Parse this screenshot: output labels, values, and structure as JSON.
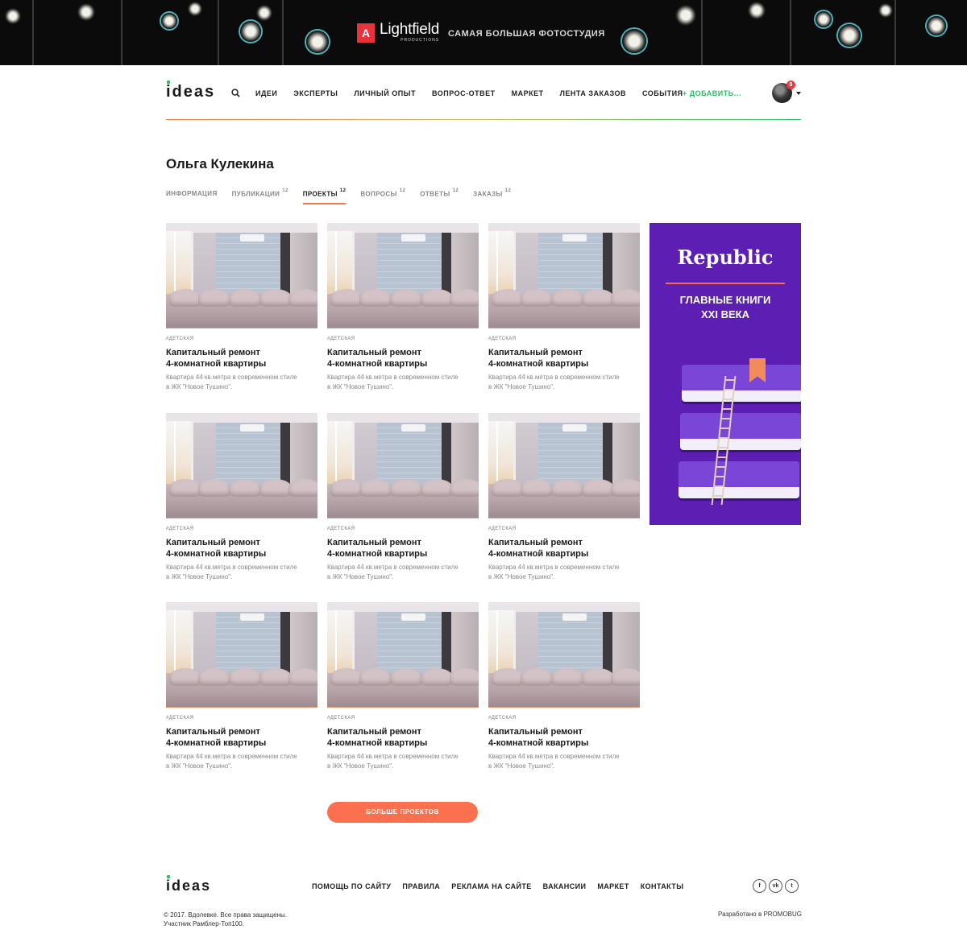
{
  "banner": {
    "logo_mark": "A",
    "logo_text": "Lightfield",
    "logo_sub": "PRODUCTIONS",
    "slogan": "САМАЯ БОЛЬШАЯ ФОТОСТУДИЯ"
  },
  "header": {
    "brand": "ideas",
    "nav": [
      "ИДЕИ",
      "ЭКСПЕРТЫ",
      "ЛИЧНЫЙ ОПЫТ",
      "ВОПРОС-ОТВЕТ",
      "МАРКЕТ",
      "ЛЕНТА ЗАКАЗОВ",
      "СОБЫТИЯ"
    ],
    "add_label": "+ ДОБАВИТЬ...",
    "notifications_count": "8"
  },
  "profile": {
    "name": "Ольга Кулекина",
    "tabs": [
      {
        "label": "ИНФОРМАЦИЯ",
        "count": ""
      },
      {
        "label": "ПУБЛИКАЦИИ",
        "count": "12"
      },
      {
        "label": "ПРОЕКТЫ",
        "count": "12"
      },
      {
        "label": "ВОПРОСЫ",
        "count": "12"
      },
      {
        "label": "ОТВЕТЫ",
        "count": "12"
      },
      {
        "label": "ЗАКАЗЫ",
        "count": "12"
      }
    ],
    "active_tab": "ПРОЕКТЫ"
  },
  "projects": [
    {
      "tag": "#ДЕТСКАЯ",
      "title": "Капитальный ремонт\n4-комнатной квартиры",
      "desc": "Квартира 44 кв.метра в современном стиле\nв ЖК \"Новое Тушино\"."
    },
    {
      "tag": "#ДЕТСКАЯ",
      "title": "Капитальный ремонт\n4-комнатной квартиры",
      "desc": "Квартира 44 кв.метра в современном стиле\nв ЖК \"Новое Тушино\"."
    },
    {
      "tag": "#ДЕТСКАЯ",
      "title": "Капитальный ремонт\n4-комнатной квартиры",
      "desc": "Квартира 44 кв.метра в современном стиле\nв ЖК \"Новое Тушино\"."
    },
    {
      "tag": "#ДЕТСКАЯ",
      "title": "Капитальный ремонт\n4-комнатной квартиры",
      "desc": "Квартира 44 кв.метра в современном стиле\nв ЖК \"Новое Тушино\"."
    },
    {
      "tag": "#ДЕТСКАЯ",
      "title": "Капитальный ремонт\n4-комнатной квартиры",
      "desc": "Квартира 44 кв.метра в современном стиле\nв ЖК \"Новое Тушино\"."
    },
    {
      "tag": "#ДЕТСКАЯ",
      "title": "Капитальный ремонт\n4-комнатной квартиры",
      "desc": "Квартира 44 кв.метра в современном стиле\nв ЖК \"Новое Тушино\"."
    },
    {
      "tag": "#ДЕТСКАЯ",
      "title": "Капитальный ремонт\n4-комнатной квартиры",
      "desc": "Квартира 44 кв.метра в современном стиле\nв ЖК \"Новое Тушино\"."
    },
    {
      "tag": "#ДЕТСКАЯ",
      "title": "Капитальный ремонт\n4-комнатной квартиры",
      "desc": "Квартира 44 кв.метра в современном стиле\nв ЖК \"Новое Тушино\"."
    },
    {
      "tag": "#ДЕТСКАЯ",
      "title": "Капитальный ремонт\n4-комнатной квартиры",
      "desc": "Квартира 44 кв.метра в современном стиле\nв ЖК \"Новое Тушино\"."
    }
  ],
  "ad": {
    "brand": "Republic",
    "text": "ГЛАВНЫЕ КНИГИ\nXXI ВЕКА"
  },
  "more_button": "БОЛЬШЕ ПРОЕКТОВ",
  "footer": {
    "brand": "ideas",
    "nav": [
      "ПОМОЩЬ ПО САЙТУ",
      "ПРАВИЛА",
      "РЕКЛАМА НА САЙТЕ",
      "ВАКАНСИИ",
      "МАРКЕТ",
      "КОНТАКТЫ"
    ],
    "social": [
      {
        "icon": "facebook-icon",
        "glyph": "f"
      },
      {
        "icon": "vk-icon",
        "glyph": "vk"
      },
      {
        "icon": "twitter-icon",
        "glyph": "t"
      }
    ],
    "copyright": "© 2017. Вдолевке. Все права защищены.\nУчастник Рамблер-Топ100.",
    "credits": "Разработано в PROMOBUG"
  },
  "colors": {
    "accent": "#fb7150",
    "green": "#27c065",
    "ad_bg": "#5c1eb3"
  }
}
